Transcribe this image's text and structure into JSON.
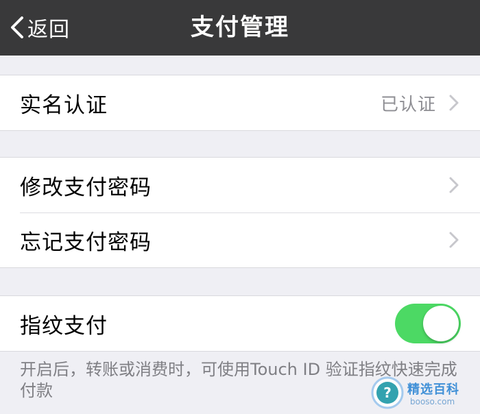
{
  "nav": {
    "back_label": "返回",
    "title": "支付管理"
  },
  "groups": {
    "verify": {
      "label": "实名认证",
      "value": "已认证"
    },
    "password": {
      "items": [
        {
          "label": "修改支付密码"
        },
        {
          "label": "忘记支付密码"
        }
      ]
    },
    "fingerprint": {
      "label": "指纹支付",
      "toggle_on": true
    }
  },
  "footnote": "开启后，转账或消费时，可使用Touch ID 验证指纹快速完成付款",
  "watermark": {
    "brand": "精选百科",
    "domain": "booso.com"
  },
  "colors": {
    "nav_bg": "#39393a",
    "toggle_on": "#4cd964",
    "page_bg": "#efeff4"
  },
  "icons": {
    "back": "chevron-left-icon",
    "row_disclosure": "chevron-right-icon",
    "watermark": "question-mark-icon"
  }
}
